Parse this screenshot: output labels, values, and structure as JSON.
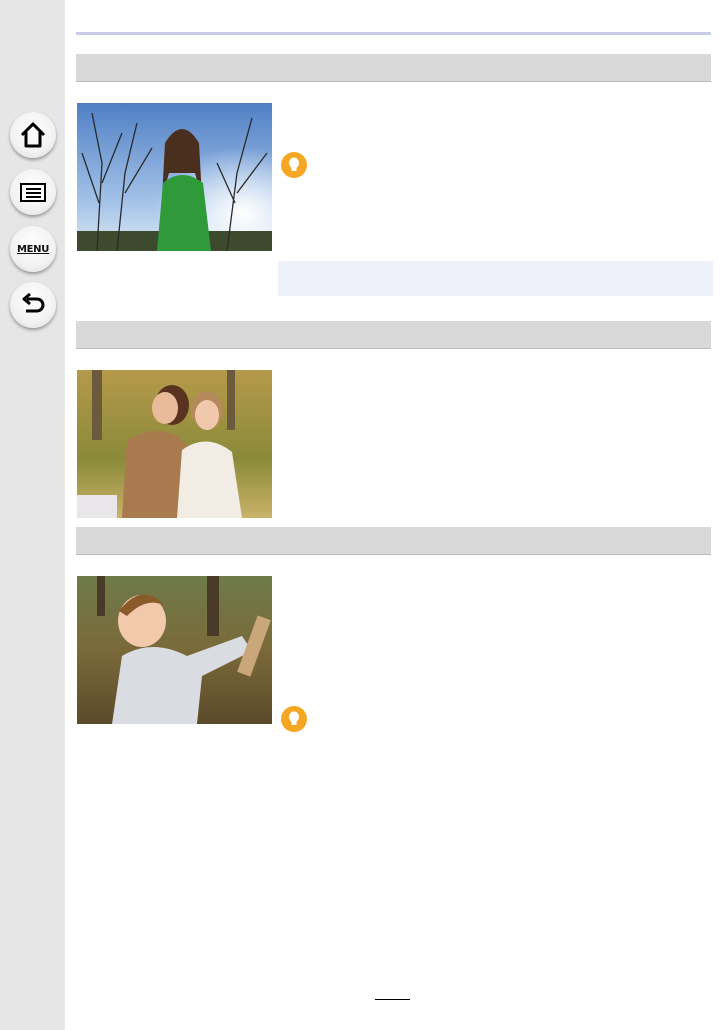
{
  "colors": {
    "sidebar_bg": "#e6e6e6",
    "section_bar": "#d9d9d9",
    "top_rule": "#c7cde6",
    "note_box": "#eef0fa",
    "tip_icon": "#f5a623"
  },
  "sidebar": {
    "items": [
      {
        "name": "home",
        "icon": "home-icon"
      },
      {
        "name": "contents",
        "icon": "list-icon"
      },
      {
        "name": "menu",
        "icon": "menu-icon",
        "label": "MENU"
      },
      {
        "name": "back",
        "icon": "back-arrow-icon"
      }
    ]
  },
  "sections": [
    {
      "photo": "woman-green-sweater-outdoors",
      "has_tip": true,
      "has_note": true
    },
    {
      "photo": "two-women-autumn-park",
      "has_tip": false,
      "has_note": false
    },
    {
      "photo": "toddler-reaching-in-park",
      "has_tip": true,
      "has_note": false
    }
  ]
}
